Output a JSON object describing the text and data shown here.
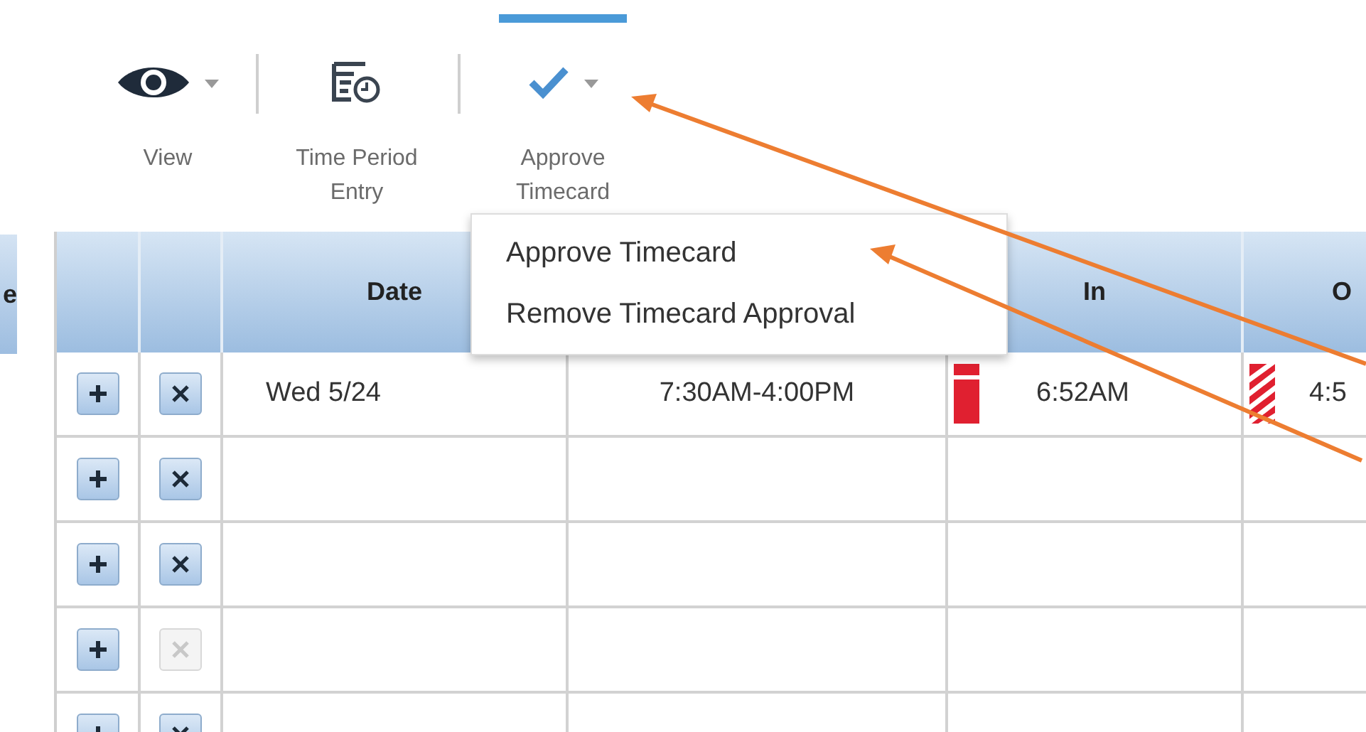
{
  "toolbar": [
    {
      "kind": "view",
      "label": "View",
      "selected": false,
      "has_caret": true
    },
    {
      "kind": "time_period",
      "label": "Time Period Entry",
      "selected": false,
      "has_caret": false
    },
    {
      "kind": "approve",
      "label": "Approve Timecard",
      "selected": true,
      "has_caret": true
    }
  ],
  "menu": {
    "items": [
      "Approve Timecard",
      "Remove Timecard Approval"
    ]
  },
  "left_fragment": "e",
  "table": {
    "columns": [
      "",
      "",
      "Date",
      "",
      "In",
      "O"
    ],
    "rows": [
      {
        "date": "Wed 5/24",
        "schedule": "7:30AM-4:00PM",
        "in": "6:52AM",
        "in_flag": true,
        "out": "4:5",
        "out_flag": true,
        "delete_disabled": false
      },
      {
        "in_flag": false,
        "out_flag": false,
        "delete_disabled": false
      },
      {
        "in_flag": false,
        "out_flag": false,
        "delete_disabled": false
      },
      {
        "in_flag": false,
        "out_flag": false,
        "delete_disabled": true
      },
      {
        "in_flag": false,
        "out_flag": false,
        "delete_disabled": false
      }
    ]
  }
}
